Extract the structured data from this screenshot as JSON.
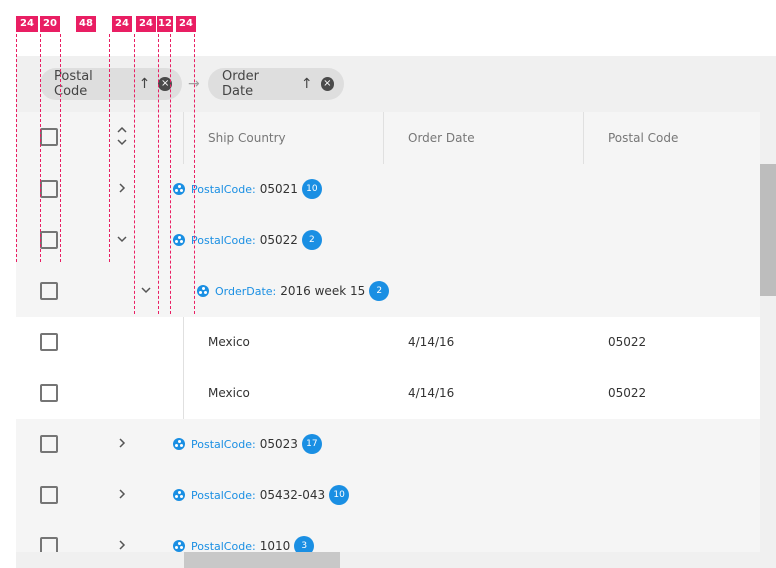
{
  "spec_labels": [
    "24",
    "20",
    "48",
    "24",
    "24",
    "12",
    "24"
  ],
  "group_bar": {
    "chips": [
      {
        "label": "Postal Code",
        "sort": "↑",
        "remove": "×"
      },
      {
        "label": "Order Date",
        "sort": "↑",
        "remove": "×"
      }
    ],
    "separator": "→"
  },
  "header": {
    "expand_all": "⌃⌄",
    "columns": [
      "Ship Country",
      "Order Date",
      "Postal Code"
    ]
  },
  "rows": [
    {
      "type": "group",
      "level": 1,
      "expanded": false,
      "field": "PostalCode:",
      "value": "05021",
      "count": "10"
    },
    {
      "type": "group",
      "level": 1,
      "expanded": true,
      "field": "PostalCode:",
      "value": "05022",
      "count": "2"
    },
    {
      "type": "group",
      "level": 2,
      "expanded": true,
      "field": "OrderDate:",
      "value": "2016 week 15",
      "count": "2"
    },
    {
      "type": "data",
      "cells": [
        "Mexico",
        "4/14/16",
        "05022"
      ]
    },
    {
      "type": "data",
      "cells": [
        "Mexico",
        "4/14/16",
        "05022"
      ]
    },
    {
      "type": "group",
      "level": 1,
      "expanded": false,
      "field": "PostalCode:",
      "value": "05023",
      "count": "17"
    },
    {
      "type": "group",
      "level": 1,
      "expanded": false,
      "field": "PostalCode:",
      "value": "05432-043",
      "count": "10"
    },
    {
      "type": "group",
      "level": 1,
      "expanded": false,
      "field": "PostalCode:",
      "value": "1010",
      "count": "3"
    }
  ],
  "icons": {
    "collapsed": "›",
    "expanded": "⌄"
  },
  "colors": {
    "accent": "#1a8fe3",
    "spec": "#e91e63",
    "background": "#f5f5f5"
  }
}
